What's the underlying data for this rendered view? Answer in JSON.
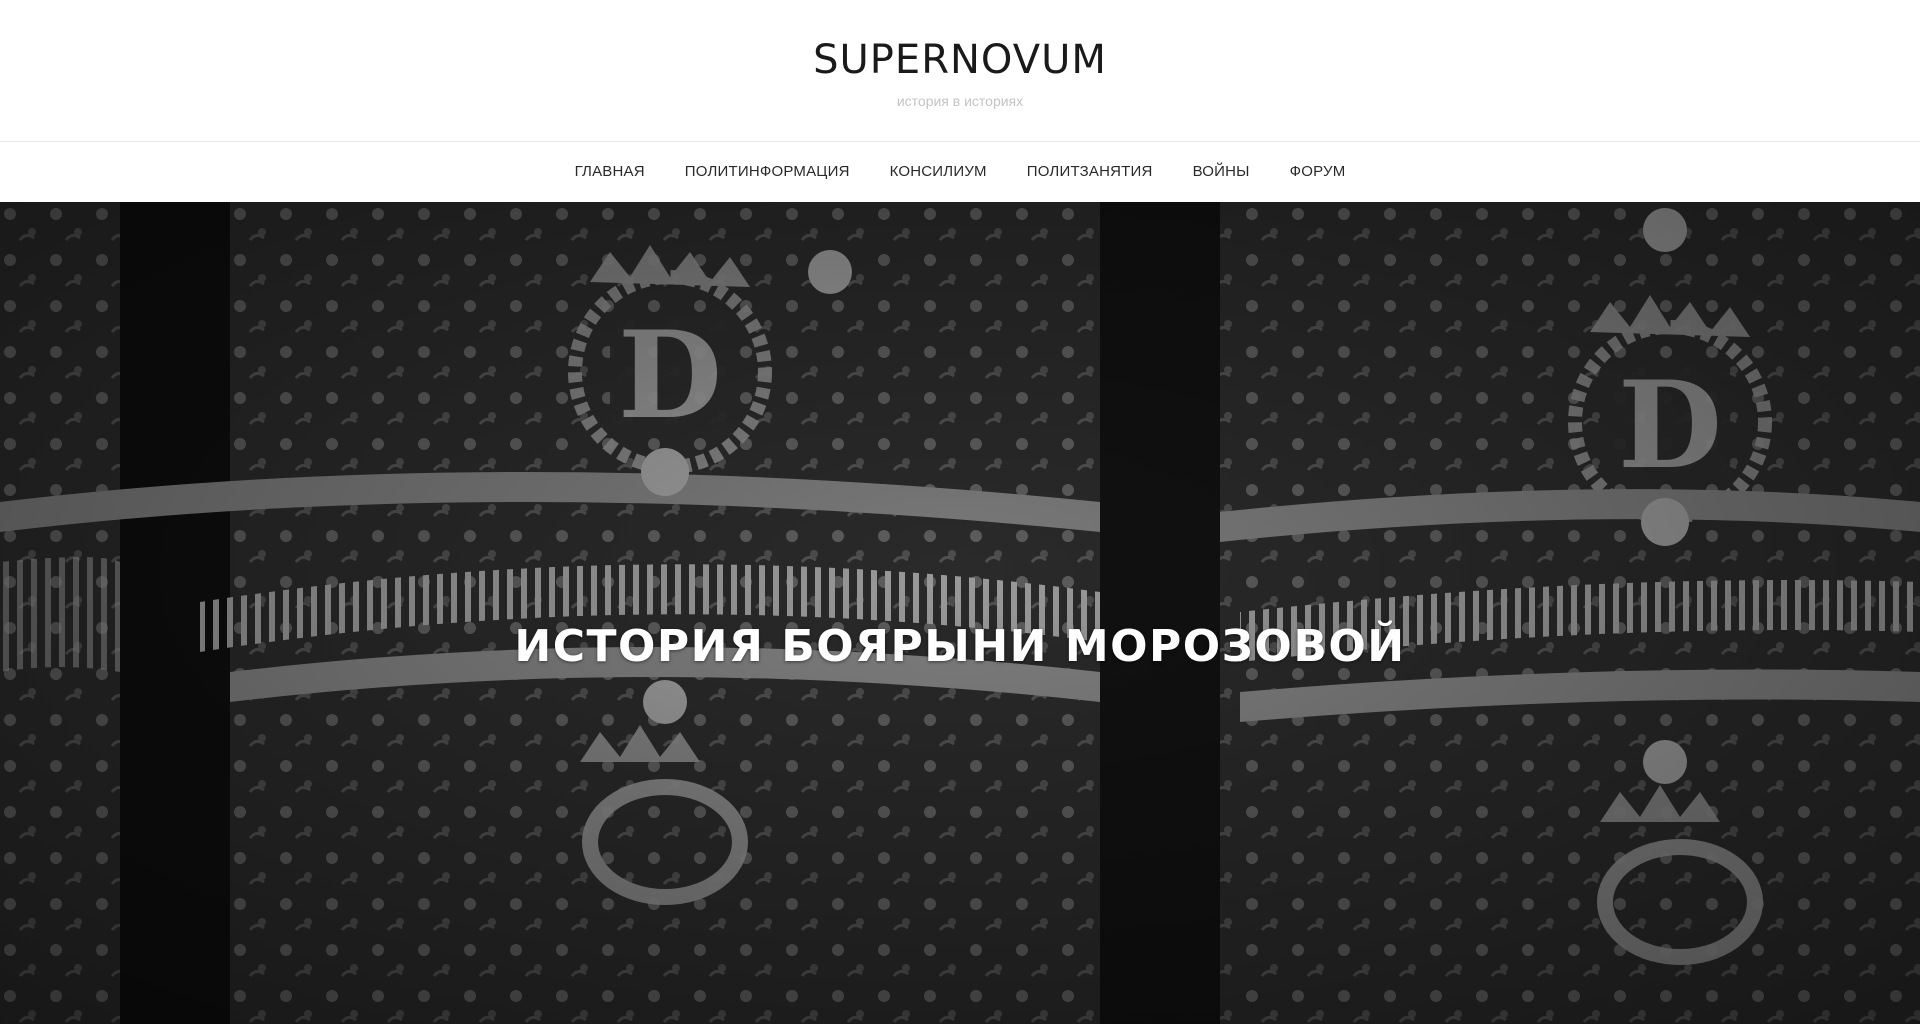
{
  "header": {
    "site_title": "SUPERNOVUM",
    "tagline": "история в историях"
  },
  "nav": {
    "items": [
      {
        "label": "ГЛАВНАЯ"
      },
      {
        "label": "ПОЛИТИНФОРМАЦИЯ"
      },
      {
        "label": "КОНСИЛИУМ"
      },
      {
        "label": "ПОЛИТЗАНЯТИЯ"
      },
      {
        "label": "ВОЙНЫ"
      },
      {
        "label": "ФОРУМ"
      }
    ]
  },
  "hero": {
    "title": "ИСТОРИЯ БОЯРЫНИ МОРОЗОВОЙ",
    "image": "grayscale embroidered fabric with crowned monogram medallions"
  },
  "colors": {
    "text_dark": "#1a1a1a",
    "tagline": "#c4c4c4",
    "divider": "#e6e6e6",
    "hero_text": "#ffffff"
  }
}
